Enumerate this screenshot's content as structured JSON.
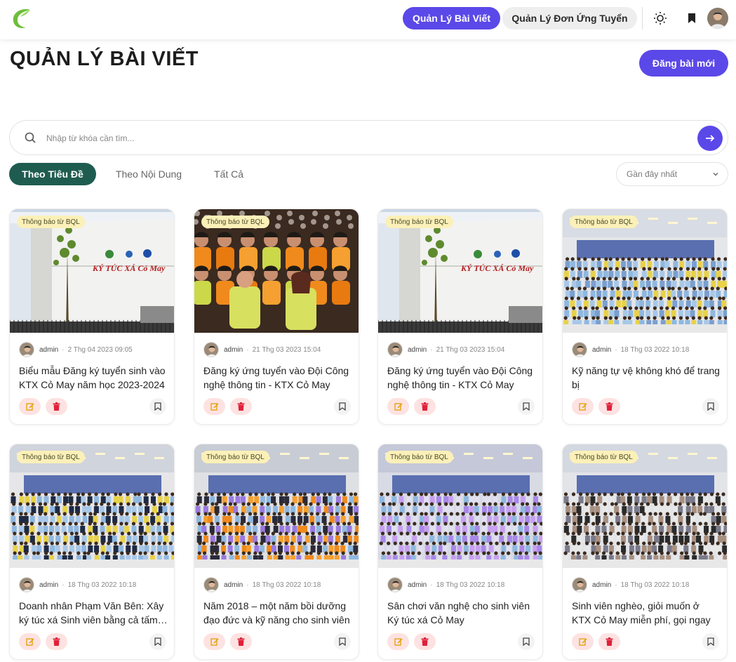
{
  "nav": {
    "posts_label": "Quản Lý Bài Viết",
    "applications_label": "Quản Lý Đơn Ứng Tuyển"
  },
  "header": {
    "title": "QUẢN LÝ BÀI VIẾT",
    "new_post_label": "Đăng bài mới"
  },
  "search": {
    "placeholder": "Nhập từ khóa cần tìm..."
  },
  "tabs": [
    {
      "label": "Theo Tiêu Đề",
      "active": true
    },
    {
      "label": "Theo Nội Dung",
      "active": false
    },
    {
      "label": "Tất Cả",
      "active": false
    }
  ],
  "sort": {
    "selected": "Gần đây nhất"
  },
  "colors": {
    "accent": "#5b48e8",
    "tab_active": "#1f5c50",
    "badge_bg": "#fbf0b8",
    "action_bg": "#fde2e2"
  },
  "icons": {
    "edit": "edit-icon",
    "delete": "trash-icon",
    "save": "bookmark-icon"
  },
  "posts": [
    {
      "badge": "Thông báo từ BQL",
      "author": "admin",
      "date": "2 Thg 04 2023 09:05",
      "title": "Biểu mẫu Đăng ký tuyển sinh vào KTX Cỏ May năm học 2023-2024"
    },
    {
      "badge": "Thông báo từ BQL",
      "author": "admin",
      "date": "21 Thg 03 2023 15:04",
      "title": "Đăng ký ứng tuyển vào Đội Công nghệ thông tin - KTX Cỏ May"
    },
    {
      "badge": "Thông báo từ BQL",
      "author": "admin",
      "date": "21 Thg 03 2023 15:04",
      "title": "Đăng ký ứng tuyển vào Đội Công nghệ thông tin - KTX Cỏ May"
    },
    {
      "badge": "Thông báo từ BQL",
      "author": "admin",
      "date": "18 Thg 03 2022 10:18",
      "title": "Kỹ năng tự vệ không khó để trang bị"
    },
    {
      "badge": "Thông báo từ BQL",
      "author": "admin",
      "date": "18 Thg 03 2022 10:18",
      "title": "Doanh nhân Phạm Văn Bên: Xây ký túc xá Sinh viên bằng cả tấm lòng"
    },
    {
      "badge": "Thông báo từ BQL",
      "author": "admin",
      "date": "18 Thg 03 2022 10:18",
      "title": "Năm 2018 – một năm bồi dưỡng đạo đức và kỹ năng cho sinh viên"
    },
    {
      "badge": "Thông báo từ BQL",
      "author": "admin",
      "date": "18 Thg 03 2022 10:18",
      "title": "Sân chơi văn nghệ cho sinh viên Ký túc xá Cỏ May"
    },
    {
      "badge": "Thông báo từ BQL",
      "author": "admin",
      "date": "18 Thg 03 2022 10:18",
      "title": "Sinh viên nghèo, giỏi muốn ở KTX Cỏ May miễn phí, gọi ngay"
    }
  ],
  "image_sign_text": "KÝ TÚC XÁ Cỏ May"
}
